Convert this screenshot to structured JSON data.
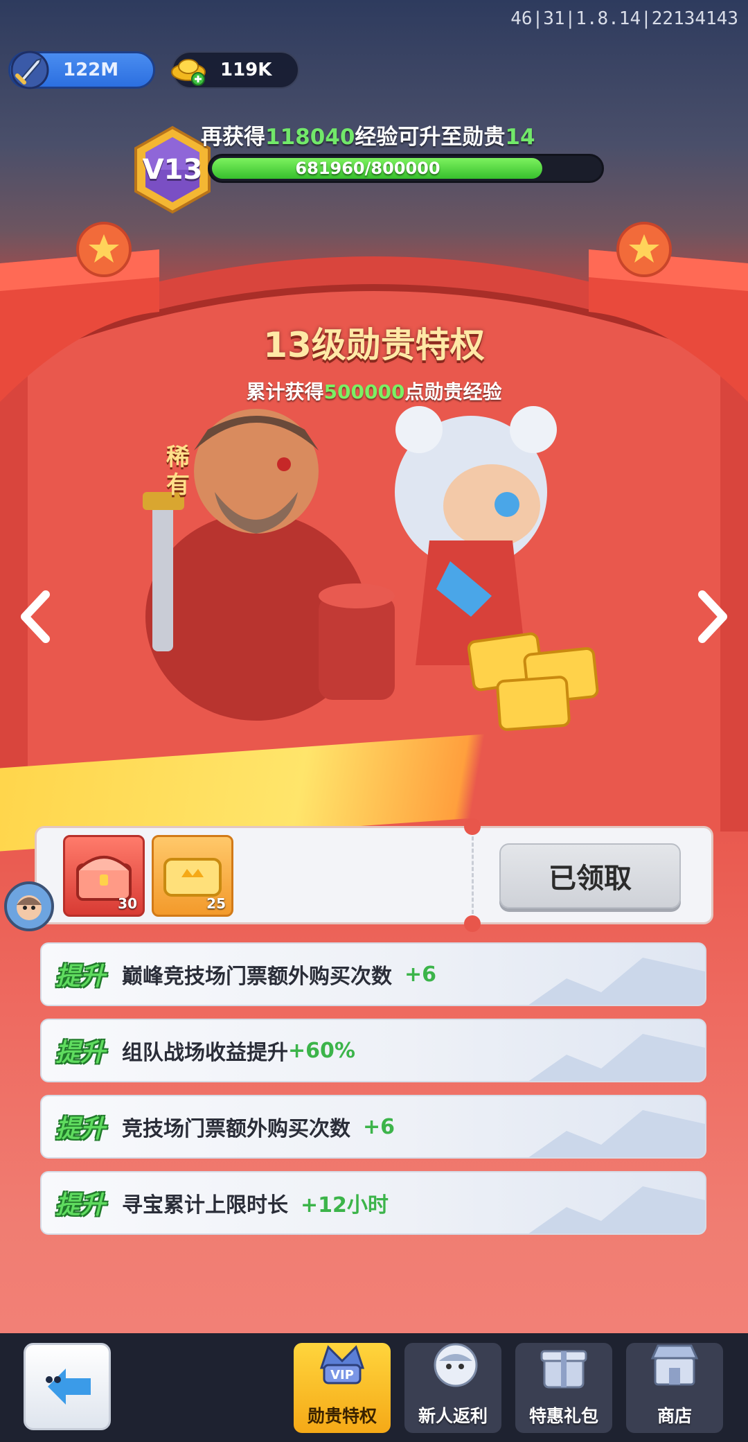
{
  "version": "46|31|1.8.14|22134143",
  "resources": {
    "power": "122M",
    "gold": "119K",
    "icons": {
      "power": "sword-icon",
      "gold": "gold-ingot-plus-icon"
    }
  },
  "vip": {
    "level_badge": "V13",
    "exp_prefix": "再获得",
    "exp_needed": "118040",
    "exp_middle": "经验可升至勋贵",
    "next_level": "14",
    "progress_text": "681960/800000",
    "progress": 0.852
  },
  "privilege": {
    "title": "13级勋贵特权",
    "sub_prefix": "累计获得",
    "sub_value": "500000",
    "sub_suffix": "点勋贵经验",
    "rare_tag": "稀有"
  },
  "rewards": {
    "items": [
      {
        "icon": "rare-hero-chest-icon",
        "count": "30"
      },
      {
        "icon": "gold-ticket-icon",
        "count": "25"
      }
    ],
    "claim_label": "已领取"
  },
  "perks": [
    {
      "tag": "提升",
      "text": "巅峰竞技场门票额外购买次数",
      "value": "+6"
    },
    {
      "tag": "提升",
      "text": "组队战场收益提升",
      "value": "+60%"
    },
    {
      "tag": "提升",
      "text": "竞技场门票额外购买次数",
      "value": "+6"
    },
    {
      "tag": "提升",
      "text": "寻宝累计上限时长",
      "value": "+12小时"
    }
  ],
  "nav": {
    "tabs": [
      {
        "label": "勋贵特权",
        "icon": "vip-crown-icon",
        "active": true
      },
      {
        "label": "新人返利",
        "icon": "mascot-thumb-icon",
        "active": false
      },
      {
        "label": "特惠礼包",
        "icon": "gift-box-icon",
        "active": false
      },
      {
        "label": "商店",
        "icon": "shop-icon",
        "active": false
      }
    ]
  },
  "colors": {
    "accent_green": "#3cb44a",
    "banner_red": "#e25a4e",
    "active_tab": "#ffd53d"
  }
}
